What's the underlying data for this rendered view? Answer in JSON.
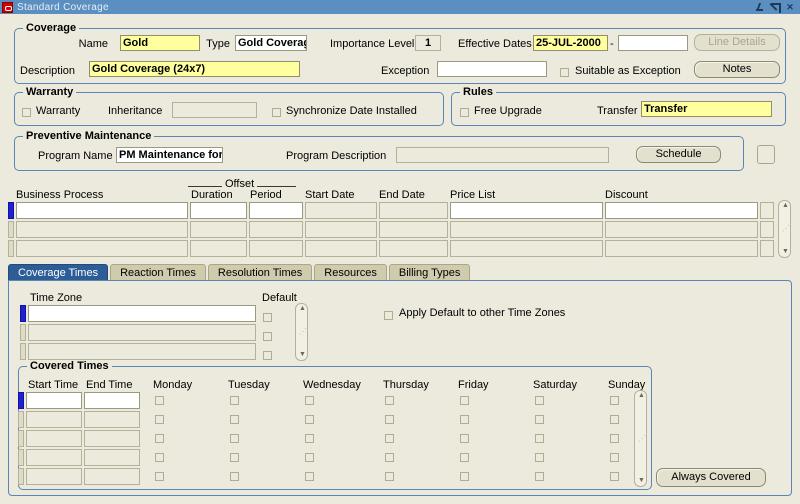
{
  "window": {
    "title": "Standard Coverage",
    "icon": "oracle-logo-icon",
    "minimize": "⤵",
    "maximize": "↗",
    "close": "✕"
  },
  "coverage": {
    "legend": "Coverage",
    "name_label": "Name",
    "name_value": "Gold",
    "type_label": "Type",
    "type_value": "Gold Coverag",
    "importance_label": "Importance Level",
    "importance_value": "1",
    "effective_dates_label": "Effective Dates",
    "effective_date_from": "25-JUL-2000",
    "effective_dates_separator": "-",
    "effective_date_to": "",
    "line_details_button": "Line Details",
    "description_label": "Description",
    "description_value": "Gold Coverage (24x7)",
    "exception_label": "Exception",
    "exception_value": "",
    "suitable_as_exception_label": "Suitable as Exception",
    "notes_button": "Notes"
  },
  "warranty": {
    "legend": "Warranty",
    "warranty_checkbox_label": "Warranty",
    "inheritance_label": "Inheritance",
    "inheritance_value": "",
    "sync_date_installed_label": "Synchronize Date Installed"
  },
  "rules": {
    "legend": "Rules",
    "free_upgrade_label": "Free Upgrade",
    "transfer_label": "Transfer",
    "transfer_value": "Transfer"
  },
  "preventive_maintenance": {
    "legend": "Preventive Maintenance",
    "program_name_label": "Program Name",
    "program_name_value": "PM Maintenance for",
    "program_description_label": "Program Description",
    "program_description_value": "",
    "schedule_button": "Schedule"
  },
  "business_process_grid": {
    "offset_group_label": "Offset",
    "columns": [
      "Business Process",
      "Duration",
      "Period",
      "Start Date",
      "End Date",
      "Price List",
      "Discount"
    ],
    "rows": [
      {
        "business_process": "",
        "duration": "",
        "period": "",
        "start_date": "",
        "end_date": "",
        "price_list": "",
        "discount": "",
        "selected": true
      },
      {
        "business_process": "",
        "duration": "",
        "period": "",
        "start_date": "",
        "end_date": "",
        "price_list": "",
        "discount": "",
        "selected": false
      },
      {
        "business_process": "",
        "duration": "",
        "period": "",
        "start_date": "",
        "end_date": "",
        "price_list": "",
        "discount": "",
        "selected": false
      }
    ],
    "scroll_up": "▲",
    "scroll_down": "▼"
  },
  "tabs": [
    {
      "label": "Coverage Times",
      "active": true
    },
    {
      "label": "Reaction Times",
      "active": false
    },
    {
      "label": "Resolution Times",
      "active": false
    },
    {
      "label": "Resources",
      "active": false
    },
    {
      "label": "Billing Types",
      "active": false
    }
  ],
  "coverage_times": {
    "time_zone_label": "Time Zone",
    "default_label": "Default",
    "apply_default_label": "Apply Default to other Time Zones",
    "rows": [
      {
        "time_zone": "",
        "selected": true
      },
      {
        "time_zone": "",
        "selected": false
      },
      {
        "time_zone": "",
        "selected": false
      }
    ],
    "scroll_up": "▲",
    "scroll_down": "▼"
  },
  "covered_times": {
    "legend": "Covered Times",
    "columns": [
      "Start Time",
      "End Time",
      "Monday",
      "Tuesday",
      "Wednesday",
      "Thursday",
      "Friday",
      "Saturday",
      "Sunday"
    ],
    "rows": [
      {
        "start_time": "",
        "end_time": "",
        "days": [
          false,
          false,
          false,
          false,
          false,
          false,
          false
        ],
        "selected": true
      },
      {
        "start_time": "",
        "end_time": "",
        "days": [
          false,
          false,
          false,
          false,
          false,
          false,
          false
        ],
        "selected": false
      },
      {
        "start_time": "",
        "end_time": "",
        "days": [
          false,
          false,
          false,
          false,
          false,
          false,
          false
        ],
        "selected": false
      },
      {
        "start_time": "",
        "end_time": "",
        "days": [
          false,
          false,
          false,
          false,
          false,
          false,
          false
        ],
        "selected": false
      },
      {
        "start_time": "",
        "end_time": "",
        "days": [
          false,
          false,
          false,
          false,
          false,
          false,
          false
        ],
        "selected": false
      }
    ],
    "always_covered_button": "Always Covered",
    "scroll_up": "▲",
    "scroll_down": "▼"
  },
  "colors": {
    "titlebar": "#5b8fc2",
    "canvas": "#eceadc",
    "required_field": "#ffff9e",
    "active_tab": "#2c5d96",
    "group_border": "#5b85b5",
    "row_selected": "#2222cc"
  }
}
